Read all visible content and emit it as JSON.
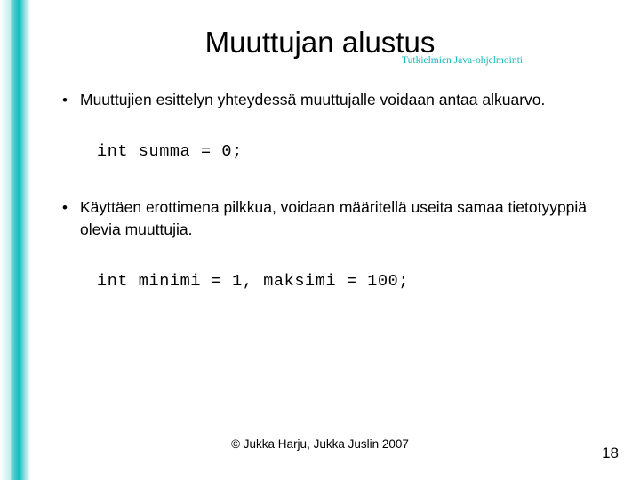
{
  "slide": {
    "title": "Muuttujan alustus",
    "subtitle": "Tutkielmien Java-ohjelmointi",
    "bullets": [
      "Muuttujien esittelyn yhteydessä muuttujalle voidaan antaa alkuarvo.",
      "Käyttäen erottimena pilkkua, voidaan määritellä useita samaa tietotyyppiä olevia muuttujia."
    ],
    "code_samples": [
      "int summa = 0;",
      "int minimi = 1, maksimi = 100;"
    ],
    "footer": "© Jukka Harju, Jukka Juslin 2007",
    "slide_number": "18",
    "accent_color": "#17b8b8"
  }
}
